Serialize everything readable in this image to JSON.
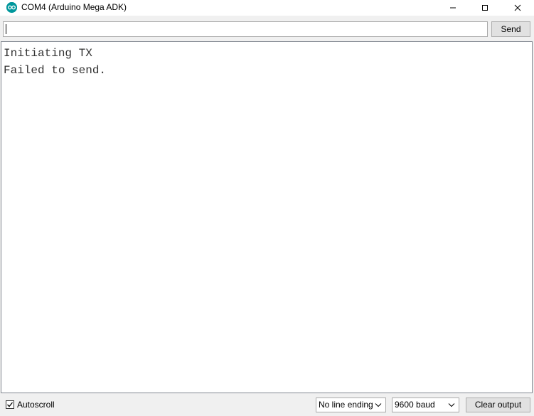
{
  "window": {
    "title": "COM4 (Arduino Mega ADK)",
    "minimize_glyph": "—",
    "maximize_glyph": "☐",
    "close_glyph": "✕"
  },
  "send": {
    "input_value": "",
    "placeholder": "",
    "button_label": "Send"
  },
  "output": {
    "lines": [
      "Initiating TX",
      "Failed to send."
    ]
  },
  "bottom_bar": {
    "autoscroll_label": "Autoscroll",
    "autoscroll_checked": true,
    "line_ending": "No line ending",
    "baud": "9600 baud",
    "clear_label": "Clear output"
  },
  "icons": {
    "app": "arduino-logo-icon",
    "checkbox": "checkmark-icon",
    "dropdown": "chevron-down-icon"
  },
  "colors": {
    "arduino_teal": "#00979c"
  }
}
